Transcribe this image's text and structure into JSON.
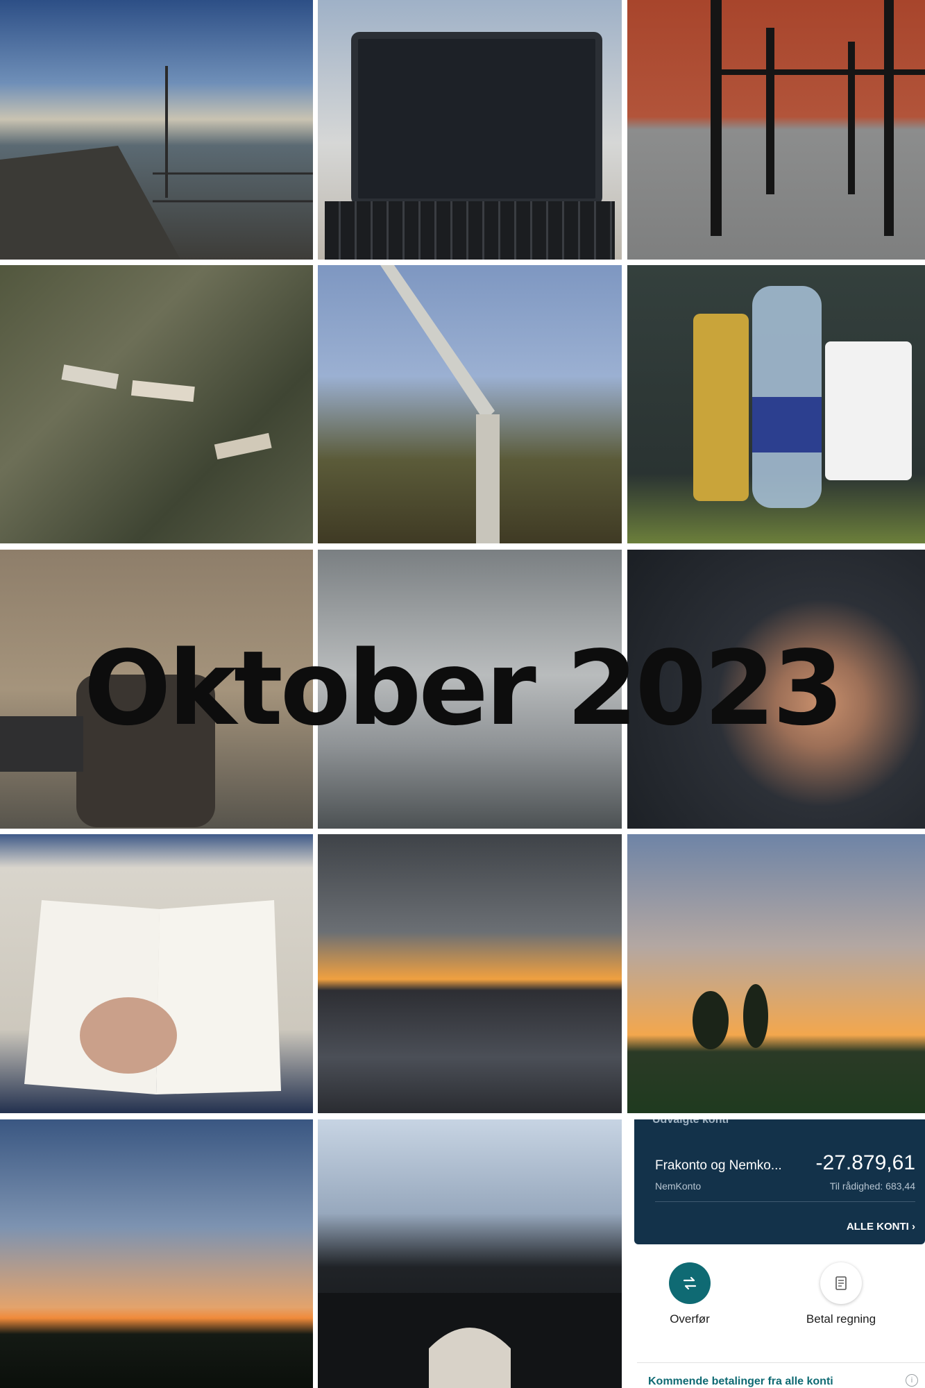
{
  "collage": {
    "title": "Oktober 2023"
  },
  "bank_widget": {
    "section_header": "Udvalgte konti",
    "account_name": "Frakonto og Nemko...",
    "account_type": "NemKonto",
    "balance": "-27.879,61",
    "available": "Til rådighed: 683,44",
    "all_accounts_link": "ALLE KONTI ›",
    "actions": [
      {
        "label": "Overfør",
        "icon": "transfer-icon",
        "color": "#0f6a73"
      },
      {
        "label": "Betal regning",
        "icon": "bill-icon",
        "color": "#ffffff"
      }
    ],
    "upcoming_label": "Kommende betalinger fra alle konti",
    "info_icon_glyph": "i"
  },
  "colors": {
    "card_background": "#13324a",
    "accent_teal": "#0f6a73"
  }
}
